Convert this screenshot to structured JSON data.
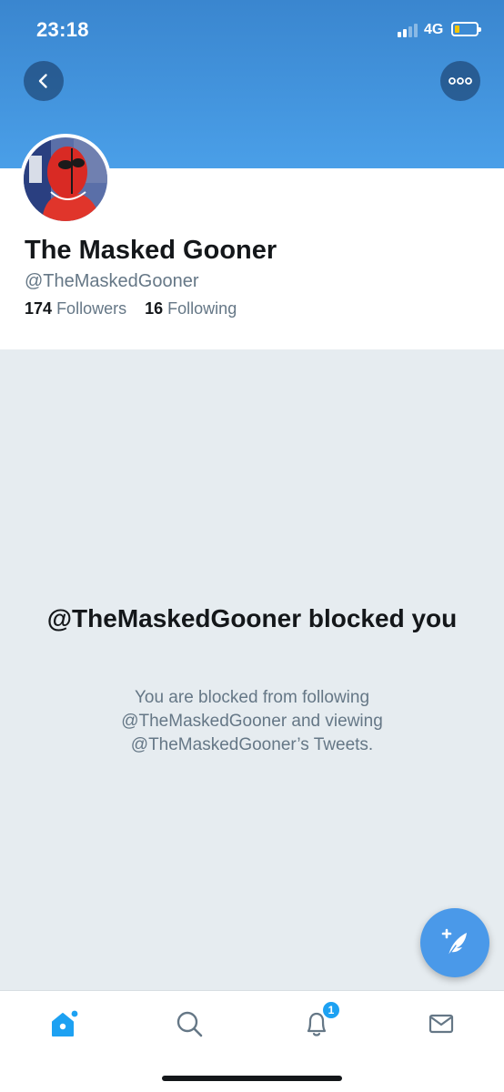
{
  "status_bar": {
    "time": "23:18",
    "network": "4G",
    "signal_bars": 4,
    "signal_bars_filled": 2,
    "battery_level": 0.2,
    "battery_color": "#f5c400"
  },
  "header": {
    "banner_color": "#4a9fe8",
    "back_icon": "chevron-left-icon",
    "more_icon": "ellipsis-icon"
  },
  "profile": {
    "name": "The Masked Gooner",
    "handle": "@TheMaskedGooner",
    "followers_count": "174",
    "followers_label": "Followers",
    "following_count": "16",
    "following_label": "Following"
  },
  "blocked": {
    "title": "@TheMaskedGooner blocked you",
    "description": "You are blocked from following @TheMaskedGooner and viewing @TheMaskedGooner’s Tweets."
  },
  "fab": {
    "icon": "compose-tweet-icon",
    "color": "#4a99e9"
  },
  "tab_bar": {
    "items": [
      {
        "name": "home",
        "icon": "home-icon",
        "active": true
      },
      {
        "name": "search",
        "icon": "search-icon",
        "active": false
      },
      {
        "name": "notifications",
        "icon": "bell-icon",
        "active": false
      },
      {
        "name": "messages",
        "icon": "envelope-icon",
        "active": false
      }
    ],
    "notification_badge": "1",
    "active_color": "#1da1f2",
    "inactive_color": "#657786"
  }
}
